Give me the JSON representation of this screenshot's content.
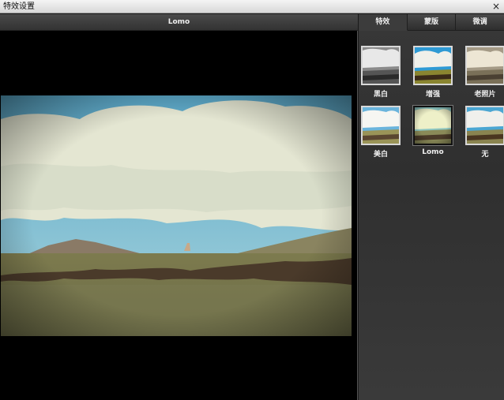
{
  "window": {
    "title": "特效设置",
    "close_glyph": "×"
  },
  "preview": {
    "title": "Lomo"
  },
  "tabs": [
    {
      "label": "特效",
      "active": true
    },
    {
      "label": "蒙版",
      "active": false
    },
    {
      "label": "微调",
      "active": false
    }
  ],
  "effects": [
    {
      "label": "黑白",
      "style": "bw",
      "selected": false
    },
    {
      "label": "增强",
      "style": "enhance",
      "selected": false
    },
    {
      "label": "老照片",
      "style": "old",
      "selected": false
    },
    {
      "label": "美白",
      "style": "whiten",
      "selected": false
    },
    {
      "label": "Lomo",
      "style": "lomo",
      "selected": true
    },
    {
      "label": "无",
      "style": "none",
      "selected": false
    }
  ]
}
